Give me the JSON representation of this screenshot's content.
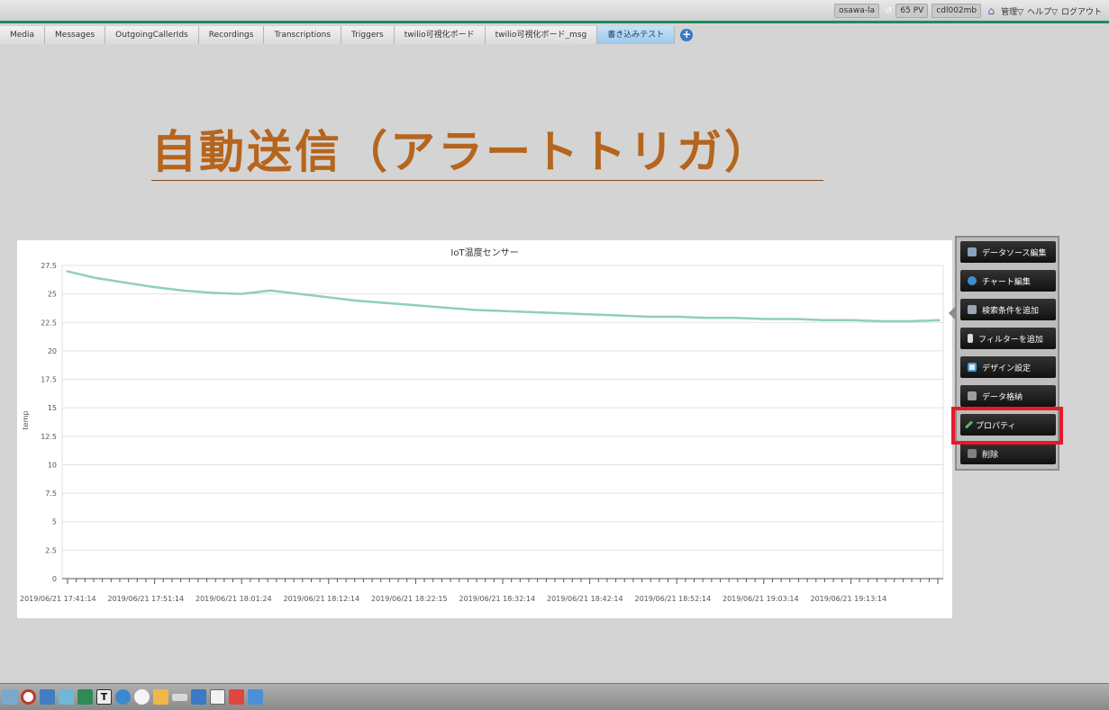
{
  "topbar": {
    "user": "osawa-la",
    "pv": "65 PV",
    "account": "cdl002mb",
    "admin": "管理▽",
    "help": "ヘルプ▽",
    "logout": "ログアウト"
  },
  "tabs": [
    {
      "label": "Media"
    },
    {
      "label": "Messages"
    },
    {
      "label": "OutgoingCallerIds"
    },
    {
      "label": "Recordings"
    },
    {
      "label": "Transcriptions"
    },
    {
      "label": "Triggers"
    },
    {
      "label": "twilio可視化ボード"
    },
    {
      "label": "twilio可視化ボード_msg"
    },
    {
      "label": "書き込みテスト"
    }
  ],
  "page": {
    "title": "自動送信（アラートトリガ）"
  },
  "menu": [
    {
      "label": "データソース編集",
      "icon": "datasource-icon"
    },
    {
      "label": "チャート編集",
      "icon": "chart-edit-icon"
    },
    {
      "label": "検索条件を追加",
      "icon": "search-condition-icon"
    },
    {
      "label": "フィルターを追加",
      "icon": "filter-icon"
    },
    {
      "label": "デザイン設定",
      "icon": "design-icon"
    },
    {
      "label": "データ格納",
      "icon": "data-store-icon"
    },
    {
      "label": "プロパティ",
      "icon": "property-icon"
    },
    {
      "label": "削除",
      "icon": "delete-icon"
    }
  ],
  "colors": {
    "accent_green": "#1f8a5f",
    "title": "#b5651d",
    "series": "#8fcfbf",
    "highlight": "#e8192a"
  },
  "chart_data": {
    "type": "line",
    "title": "IoT温度センサー",
    "ylabel": "temp",
    "xlabel": "",
    "ylim": [
      0,
      27.5
    ],
    "yticks": [
      "0",
      "2.5",
      "5",
      "7.5",
      "10",
      "12.5",
      "15",
      "17.5",
      "20",
      "22.5",
      "25",
      "27.5"
    ],
    "xticks": [
      "2019/06/21 17:41:14",
      "2019/06/21 17:51:14",
      "2019/06/21 18:01:24",
      "2019/06/21 18:12:14",
      "2019/06/21 18:22:15",
      "2019/06/21 18:32:14",
      "2019/06/21 18:42:14",
      "2019/06/21 18:52:14",
      "2019/06/21 19:03:14",
      "2019/06/21 19:13:14"
    ],
    "series": [
      {
        "values": [
          27.0,
          26.4,
          26.0,
          25.6,
          25.3,
          25.1,
          25.0,
          25.3,
          25.0,
          24.7,
          24.4,
          24.2,
          24.0,
          23.8,
          23.6,
          23.5,
          23.4,
          23.3,
          23.2,
          23.1,
          23.0,
          23.0,
          22.9,
          22.9,
          22.8,
          22.8,
          22.7,
          22.7,
          22.6,
          22.6,
          22.7
        ]
      }
    ]
  }
}
